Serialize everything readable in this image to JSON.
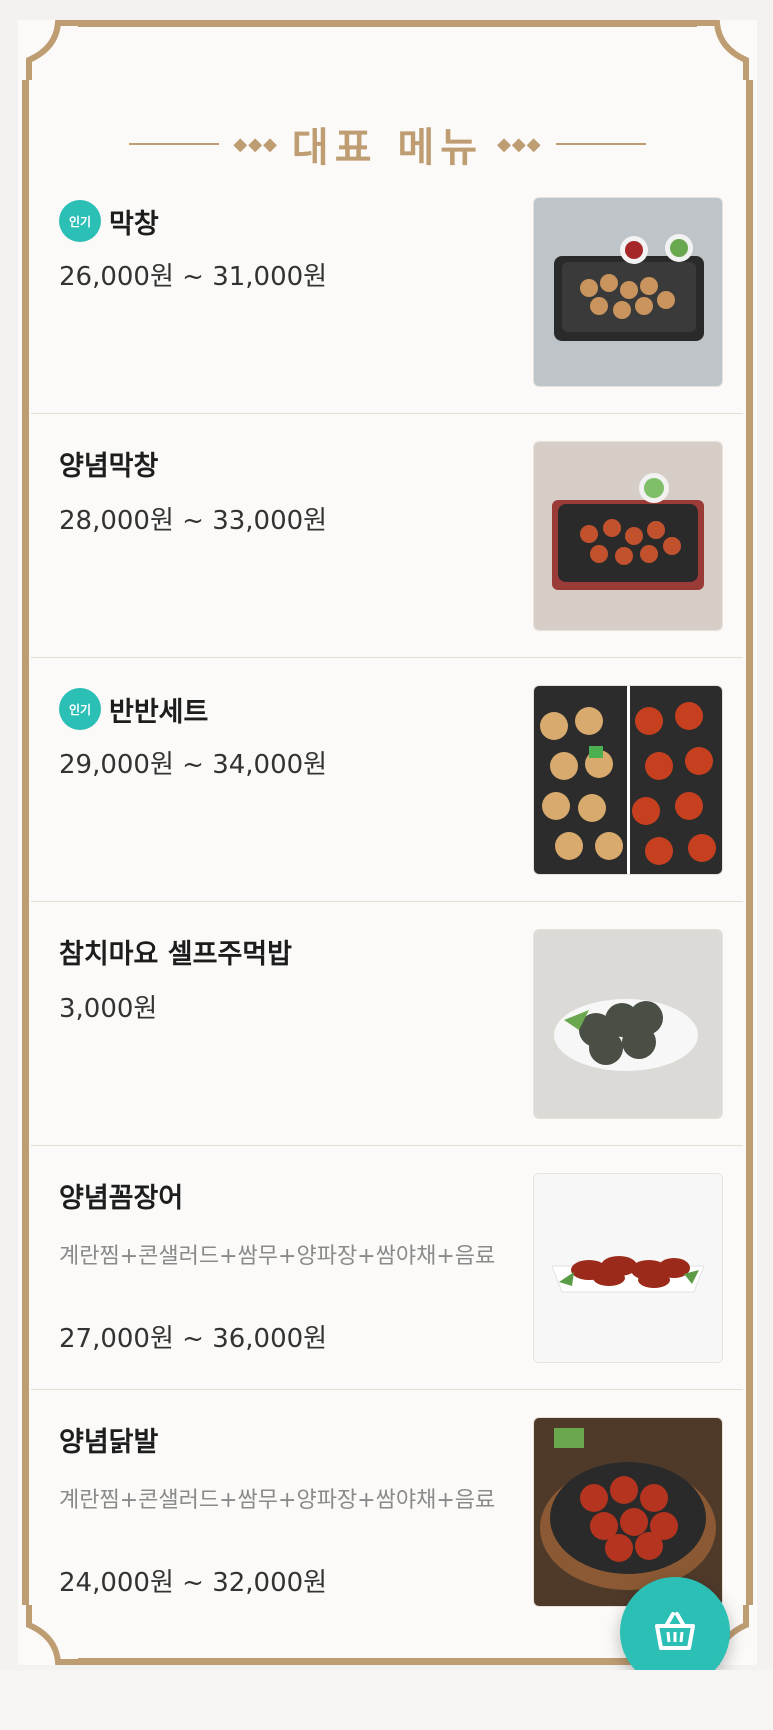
{
  "section": {
    "title": "대표 메뉴"
  },
  "menu": {
    "items": [
      {
        "name": "막창",
        "popular": true,
        "badge": "인기",
        "price": "26,000원 ~ 31,000원",
        "desc": ""
      },
      {
        "name": "양념막창",
        "popular": false,
        "badge": "",
        "price": "28,000원 ~ 33,000원",
        "desc": ""
      },
      {
        "name": "반반세트",
        "popular": true,
        "badge": "인기",
        "price": "29,000원 ~ 34,000원",
        "desc": ""
      },
      {
        "name": "참치마요 셀프주먹밥",
        "popular": false,
        "badge": "",
        "price": "3,000원",
        "desc": ""
      },
      {
        "name": "양념꼼장어",
        "popular": false,
        "badge": "",
        "price": "27,000원 ~ 36,000원",
        "desc": "계란찜+콘샐러드+쌈무+양파장+쌈야채+음료"
      },
      {
        "name": "양념닭발",
        "popular": false,
        "badge": "",
        "price": "24,000원 ~ 32,000원",
        "desc": "계란찜+콘샐러드+쌈무+양파장+쌈야채+음료"
      }
    ]
  },
  "icons": {
    "cart": "shopping-basket-icon"
  },
  "colors": {
    "accent": "#2cbfb6",
    "frame": "#bf9d72",
    "background": "#fbfaf8"
  }
}
